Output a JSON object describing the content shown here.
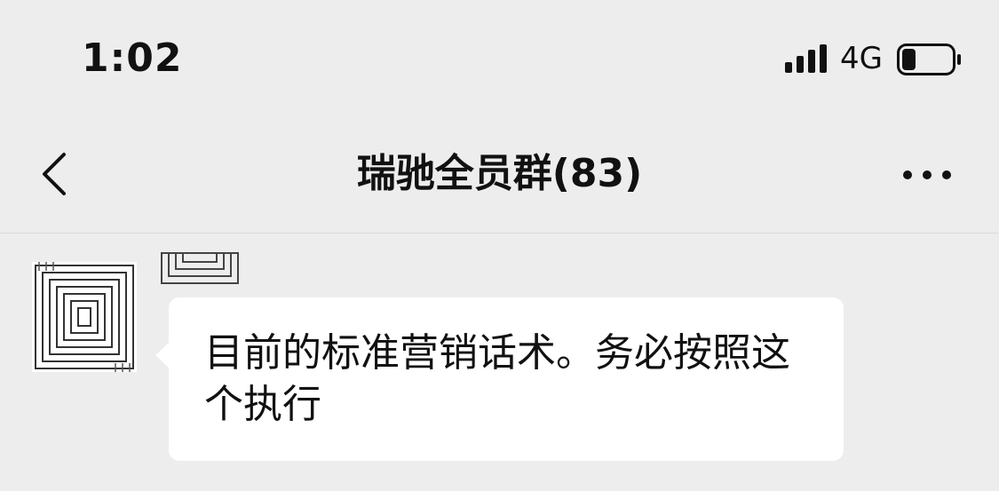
{
  "status_bar": {
    "time": "1:02",
    "network": "4G",
    "battery_level": 0.25,
    "signal_bars": 4
  },
  "nav": {
    "title": "瑞驰全员群(83)",
    "back_icon": "chevron-left-icon",
    "more_icon": "more-dots-icon"
  },
  "message": {
    "text": "目前的标准营销话术。务必按照这个执行",
    "bubble_color": "#ffffff"
  },
  "colors": {
    "background": "#ededed",
    "text": "#111111"
  }
}
